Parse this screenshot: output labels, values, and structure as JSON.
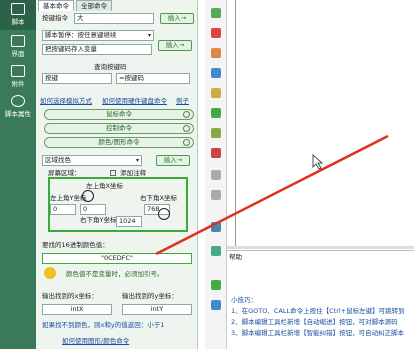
{
  "rail": {
    "items": [
      "脚本",
      "界面",
      "附件",
      "脚本属性"
    ]
  },
  "tabs": [
    "基本命令",
    "全部命令"
  ],
  "top": {
    "key_label": "按键指令",
    "key_value": "大",
    "insert_label": "插入→"
  },
  "pause": {
    "select_value": "脚本暂停：按任意键继续",
    "insert_label": "插入→",
    "store_label": "把按键码存入变量"
  },
  "keycode": {
    "title": "查询按键码",
    "key_label": "按键",
    "code_label": "=按键码"
  },
  "links": {
    "left": "如何选择模拟方式",
    "middle": "如何使用硬件键盘命令",
    "right": "例子"
  },
  "sections": [
    "鼠标命令",
    "控制命令",
    "颜色/图形命令"
  ],
  "region": {
    "select_value": "区域找色",
    "insert_label": "插入→",
    "screen_label": "屏幕区域：",
    "add_note_label": "添加注释",
    "top_left_label": "左上角X坐标",
    "left_top_label": "左上角Y坐标",
    "right_bottom_x_label": "右下角X坐标",
    "right_bottom_y_label": "右下角Y坐标",
    "left_x_value": "0",
    "left_y_value": "0",
    "right_x_value": "768",
    "right_y_value": "1024"
  },
  "color": {
    "label": "要找的16进制颜色值：",
    "value": "\"0CEDFC\"",
    "tip": "颜色值不是变量时，必须加引号。"
  },
  "output": {
    "x_label": "输出找到的x坐标：",
    "y_label": "输出找到的y坐标：",
    "x_value": "intX",
    "y_value": "intY",
    "note": "如果找不到颜色，则x和y的值返回：小于1",
    "bottom_link": "如何使用图形/颜色命令"
  },
  "help": {
    "title": "帮助",
    "subtitle": "小技巧：",
    "line1": "1、在GOTO、CALL命令上按住【Ctrl+鼠标左键】可跳转到",
    "line2": "2、脚本编辑工具栏新增【自动缩进】按钮，可对脚本源码",
    "line3": "3、脚本编辑工具栏新增【智能纠错】按钮，可自动纠正脚本"
  },
  "colors": {
    "rail": "#3a7a5a",
    "accent_green": "#3aaa3a",
    "arrow_red": "#e03020",
    "link_blue": "#1a4fa0"
  }
}
